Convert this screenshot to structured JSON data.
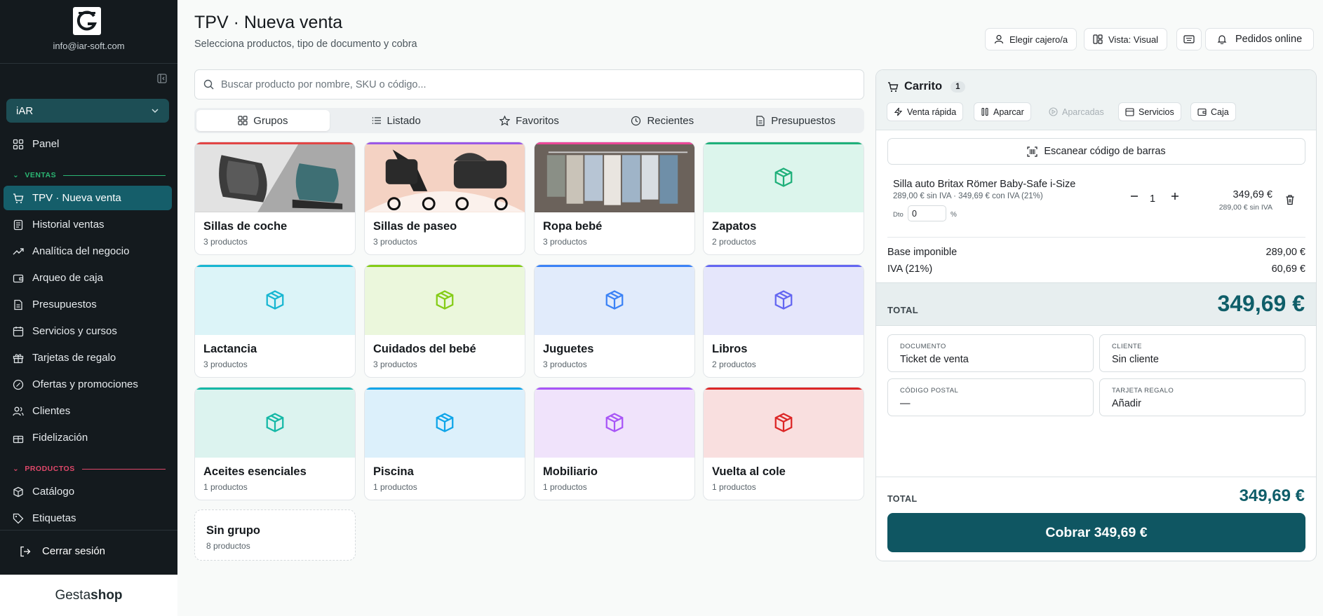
{
  "sidebar": {
    "email": "info@iar-soft.com",
    "store": "iAR",
    "items": [
      {
        "label": "Panel"
      },
      {
        "label": "TPV · Nueva venta"
      },
      {
        "label": "Historial ventas"
      },
      {
        "label": "Analítica del negocio"
      },
      {
        "label": "Arqueo de caja"
      },
      {
        "label": "Presupuestos"
      },
      {
        "label": "Servicios y cursos"
      },
      {
        "label": "Tarjetas de regalo"
      },
      {
        "label": "Ofertas y promociones"
      },
      {
        "label": "Clientes"
      },
      {
        "label": "Fidelización"
      },
      {
        "label": "Catálogo"
      },
      {
        "label": "Etiquetas"
      }
    ],
    "sections": {
      "ventas": "VENTAS",
      "productos": "PRODUCTOS"
    },
    "section_colors": {
      "ventas": "#2bb673",
      "productos": "#e0486a"
    },
    "logout": "Cerrar sesión",
    "brand_a": "Gesta",
    "brand_b": "shop"
  },
  "header": {
    "title": "TPV · Nueva venta",
    "subtitle": "Selecciona productos, tipo de documento y cobra",
    "buttons": {
      "cashier": "Elegir cajero/a",
      "view": "Vista: Visual",
      "online": "Pedidos online"
    }
  },
  "search": {
    "placeholder": "Buscar producto por nombre, SKU o código..."
  },
  "tabs": [
    "Grupos",
    "Listado",
    "Favoritos",
    "Recientes",
    "Presupuestos"
  ],
  "categories": [
    {
      "name": "Sillas de coche",
      "count": "3 productos",
      "accent": "#e24545"
    },
    {
      "name": "Sillas de paseo",
      "count": "3 productos",
      "accent": "#9b59e6"
    },
    {
      "name": "Ropa bebé",
      "count": "3 productos",
      "accent": "#ec4899"
    },
    {
      "name": "Zapatos",
      "count": "2 productos",
      "accent": "#1fb07a"
    },
    {
      "name": "Lactancia",
      "count": "3 productos",
      "accent": "#17b6d1"
    },
    {
      "name": "Cuidados del bebé",
      "count": "3 productos",
      "accent": "#84cc16"
    },
    {
      "name": "Juguetes",
      "count": "3 productos",
      "accent": "#3b82f6"
    },
    {
      "name": "Libros",
      "count": "2 productos",
      "accent": "#6366f1"
    },
    {
      "name": "Aceites esenciales",
      "count": "1 productos",
      "accent": "#14b8a6"
    },
    {
      "name": "Piscina",
      "count": "1 productos",
      "accent": "#0ea5e9"
    },
    {
      "name": "Mobiliario",
      "count": "1 productos",
      "accent": "#a855f7"
    },
    {
      "name": "Vuelta al cole",
      "count": "1 productos",
      "accent": "#dc2626"
    },
    {
      "name": "Sin grupo",
      "count": "8 productos"
    }
  ],
  "cart": {
    "title": "Carrito",
    "count": "1",
    "actions": {
      "quick": "Venta rápida",
      "park": "Aparcar",
      "parked": "Aparcadas",
      "services": "Servicios",
      "till": "Caja"
    },
    "scan": "Escanear código de barras",
    "line": {
      "name": "Silla auto Britax Römer Baby-Safe i-Size",
      "price": "289,00 € sin IVA · 349,69 € con IVA (21%)",
      "dto_label": "Dto",
      "dto_value": "0",
      "pct": "%",
      "qty": "1",
      "total": "349,69 €",
      "net": "289,00 € sin IVA"
    },
    "summary": {
      "base_label": "Base imponible",
      "base_value": "289,00 €",
      "iva_label": "IVA (21%)",
      "iva_value": "60,69 €"
    },
    "total_label": "TOTAL",
    "total_value": "349,69 €",
    "fields": {
      "doc_label": "DOCUMENTO",
      "doc_value": "Ticket de venta",
      "client_label": "CLIENTE",
      "client_value": "Sin cliente",
      "cp_label": "CÓDIGO POSTAL",
      "cp_value": "—",
      "gift_label": "TARJETA REGALO",
      "gift_value": "Añadir"
    },
    "footer_total_label": "TOTAL",
    "footer_total_value": "349,69 €",
    "pay_button": "Cobrar 349,69 €"
  },
  "colors": {
    "accent": "#0f5e69",
    "active_nav": "#155e6a"
  }
}
